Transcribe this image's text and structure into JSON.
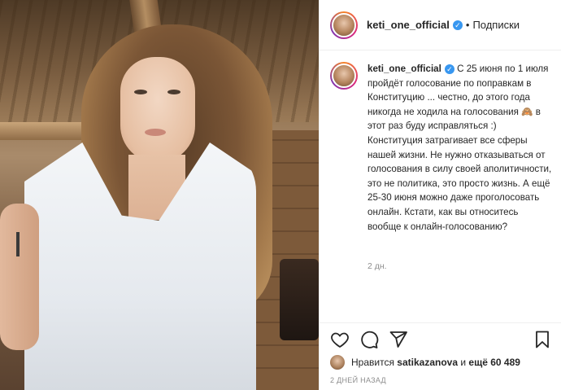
{
  "post": {
    "username": "keti_one_official",
    "verified_icon": "verified-badge-icon",
    "separator": "•",
    "follow_label": "Подписки",
    "caption": "С 25 июня по 1 июля пройдёт голосование по поправкам в Конституцию ... честно, до этого года никогда не ходила на голосования 🙈 в этот раз буду исправляться :) Конституция затрагивает все сферы нашей жизни. Не нужно отказываться от голосования в силу своей аполитичности, это не политика, это просто жизнь. А ещё 25-30 июня можно даже проголосовать онлайн. Кстати, как вы относитесь вообще к онлайн-голосованию?",
    "caption_time": "2 дн.",
    "likes_prefix": "Нравится",
    "likes_user": "satikazanova",
    "likes_and": "и",
    "likes_more": "ещё 60 489",
    "date": "2 ДНЕЙ НАЗАД"
  },
  "actions": {
    "like_icon": "heart-icon",
    "comment_icon": "comment-icon",
    "share_icon": "share-icon",
    "save_icon": "bookmark-icon"
  },
  "colors": {
    "accent": "#3897f0",
    "muted": "#8e8e8e",
    "text": "#262626",
    "border": "#efefef"
  }
}
